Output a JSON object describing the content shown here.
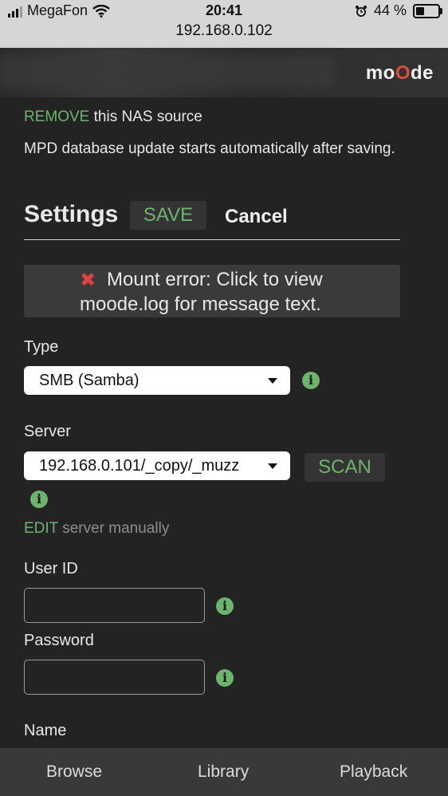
{
  "status": {
    "carrier": "MegaFon",
    "time": "20:41",
    "battery": "44 %",
    "battery_level": 0.44,
    "url": "192.168.0.102"
  },
  "header": {
    "logo_left": "mo",
    "logo_o": "O",
    "logo_right": "de"
  },
  "page": {
    "remove_link": "REMOVE",
    "remove_rest": " this NAS source",
    "notice": "MPD database update starts automatically after saving.",
    "title": "Settings",
    "save_label": "SAVE",
    "cancel_label": "Cancel",
    "error_line1": "Mount error: Click to view",
    "error_line2": "moode.log for message text.",
    "type_label": "Type",
    "type_value": "SMB (Samba)",
    "server_label": "Server",
    "server_value": "192.168.0.101/_copy/_muzz",
    "scan_label": "SCAN",
    "edit_link": "EDIT",
    "edit_rest": " server manually",
    "userid_label": "User ID",
    "password_label": "Password",
    "name_label": "Name"
  },
  "tabs": {
    "browse": "Browse",
    "library": "Library",
    "playback": "Playback"
  }
}
